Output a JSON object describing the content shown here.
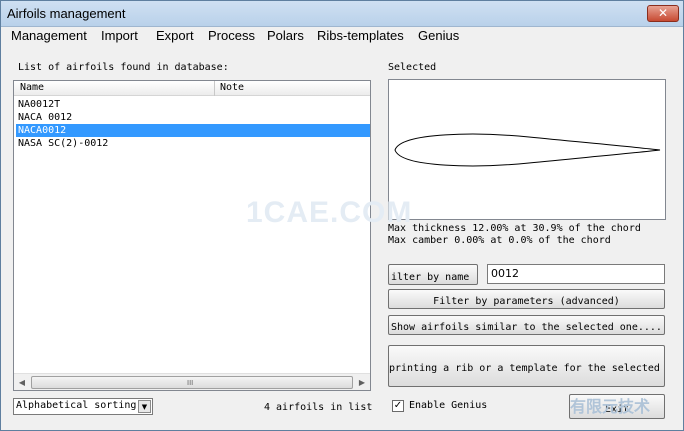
{
  "window": {
    "title": "Airfoils management",
    "close_glyph": "✕"
  },
  "menu": [
    "Management",
    "Import",
    "Export",
    "Process",
    "Polars",
    "Ribs-templates",
    "Genius"
  ],
  "list": {
    "caption": "List of airfoils found in database:",
    "columns": [
      "Name",
      "Note"
    ],
    "rows": [
      "NA0012T",
      "NACA 0012",
      "NACA0012",
      "NASA SC(2)-0012"
    ],
    "selected_index": 2,
    "scroll_grip": "III"
  },
  "preview": {
    "caption": "Selected",
    "info_line1": "Max thickness 12.00% at 30.9% of the chord",
    "info_line2": "Max camber  0.00% at 0.0% of the chord"
  },
  "filter": {
    "button_label": "ilter by name -",
    "value": "0012",
    "params_button": "Filter by parameters (advanced)",
    "similar_button": "Show airfoils similar to the selected one....",
    "print_button": "printing a rib or a template for the selected a"
  },
  "footer": {
    "sort_value": "Alphabetical sorting",
    "count_text": "4 airfoils in list",
    "enable_genius_label": "Enable Genius",
    "enable_genius_checked": true,
    "exit_label": "Exit"
  },
  "watermarks": {
    "center": "1CAE.COM",
    "corner": "有限元技术"
  },
  "icons": {
    "close": "close-icon",
    "dropdown": "chevron-down-icon",
    "scroll_left": "arrow-left-icon",
    "scroll_right": "arrow-right-icon"
  }
}
